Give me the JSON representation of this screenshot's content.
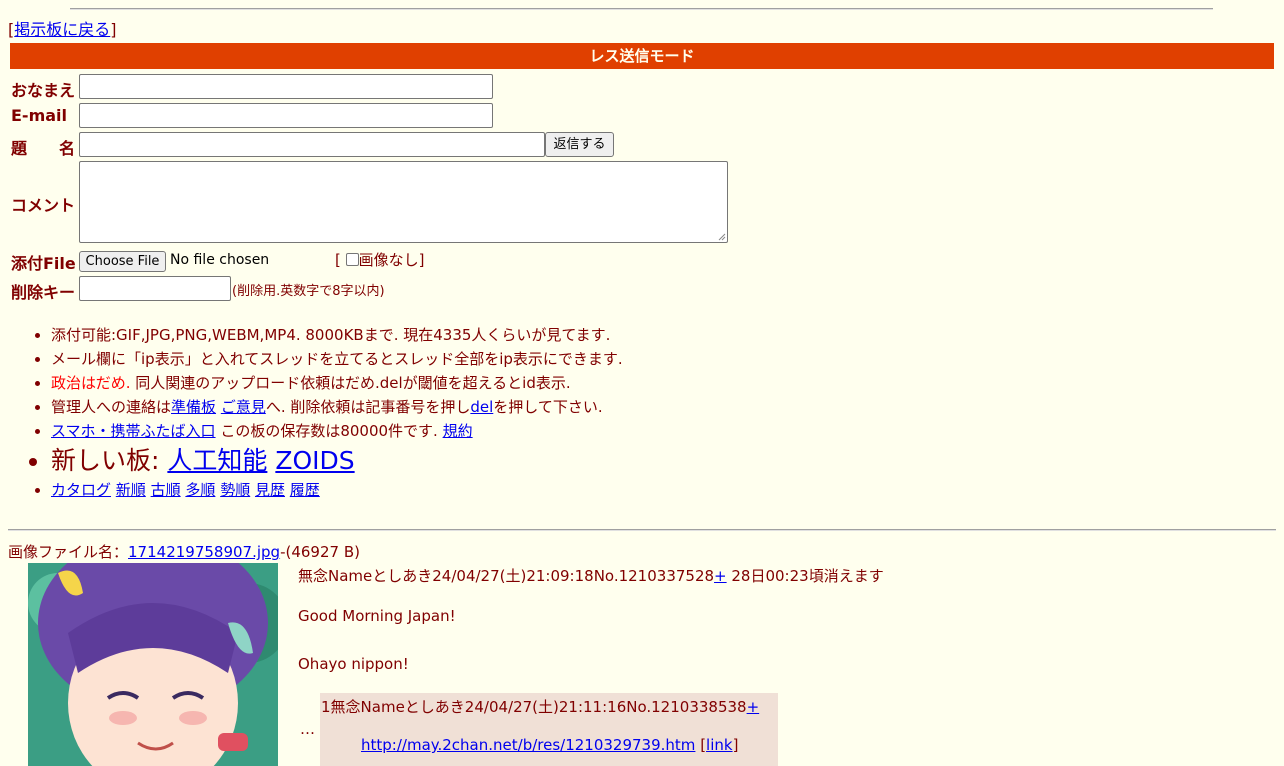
{
  "back_link": {
    "bracket_open": "[",
    "label": "掲示板に戻る",
    "bracket_close": "]"
  },
  "form": {
    "mode_title": "レス送信モード",
    "name_label": "おなまえ",
    "email_label": "E-mail",
    "subject_label": "題　　名",
    "submit_label": "返信する",
    "comment_label": "コメント",
    "file_label": "添付File",
    "choose_file_label": "Choose File",
    "no_file_text": "No file chosen",
    "no_image_open": "[",
    "no_image_label": "画像なし",
    "no_image_close": "]",
    "delkey_label": "削除キー",
    "delkey_hint": "(削除用.英数字で8字以内)"
  },
  "notes": {
    "line1": "添付可能:GIF,JPG,PNG,WEBM,MP4. 8000KBまで. 現在4335人くらいが見てます.",
    "line2": "メール欄に「ip表示」と入れてスレッドを立てるとスレッド全部をip表示にできます.",
    "line3_red": "政治はだめ.",
    "line3_rest": " 同人関連のアップロード依頼はだめ.delが閾値を超えるとid表示.",
    "line4_a": "管理人への連絡は",
    "line4_link1": "準備板",
    "line4_link2": "ご意見",
    "line4_b": "へ. 削除依頼は記事番号を押し",
    "line4_link3": "del",
    "line4_c": "を押して下さい.",
    "line5_link": "スマホ・携帯ふたば入口",
    "line5_text": " この板の保存数は80000件です. ",
    "line5_link2": "規約",
    "new_boards_label": "新しい板: ",
    "new_board1": "人工知能",
    "new_board2": "ZOIDS",
    "sort_links": [
      "カタログ",
      "新順",
      "古順",
      "多順",
      "勢順",
      "見歴",
      "履歴"
    ]
  },
  "thread": {
    "image_label": "画像ファイル名：",
    "image_file": "1714219758907.jpg",
    "image_size": "-(46927 B)",
    "header": "無念Nameとしあき24/04/27(土)21:09:18No.1210337528",
    "plus": "+",
    "expire": " 28日00:23頃消えます",
    "body_line1": "Good Morning Japan!",
    "body_line2": "Ohayo nippon!",
    "ellipsis": "…",
    "reply": {
      "header": "1無念Nameとしあき24/04/27(土)21:11:16No.1210338538",
      "plus": "+",
      "link_url": "http://may.2chan.net/b/res/1210329739.htm",
      "link_open": " [",
      "link_label": "link",
      "link_close": "]"
    }
  },
  "colors": {
    "bg": "#ffffee",
    "text": "#800000",
    "accent": "#e04000",
    "reply_bg": "#f0e0d6",
    "link": "#0000ee"
  }
}
